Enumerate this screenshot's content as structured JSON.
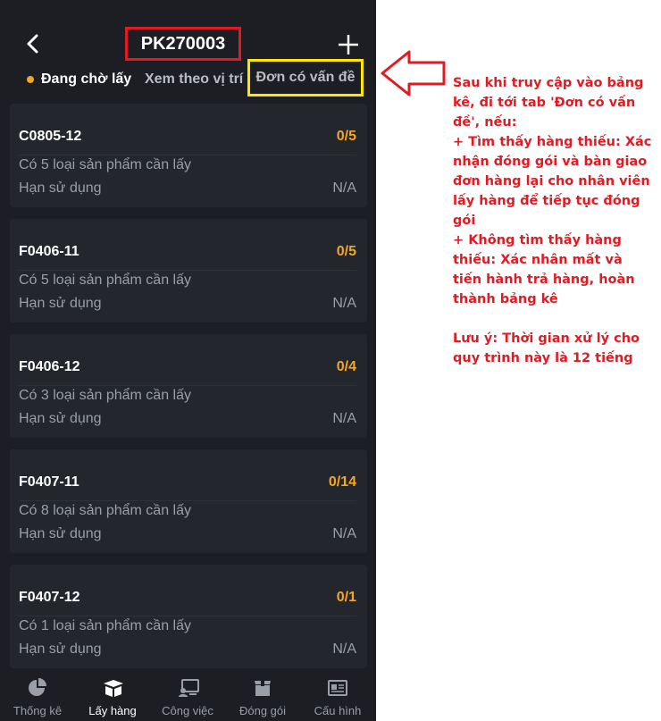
{
  "header": {
    "back_icon": "chevron-left-icon",
    "title": "PK270003",
    "add_icon": "plus-icon"
  },
  "tabs": [
    {
      "label": "Đang chờ lấy",
      "status_dot_color": "#f5a623"
    },
    {
      "label": "Xem theo vị trí"
    },
    {
      "label": "Đơn có vấn đề"
    }
  ],
  "cards": [
    {
      "code": "C0805-12",
      "count": "0/5",
      "desc": "Có 5 loại sản phẩm cần lấy",
      "expiry_label": "Hạn sử dụng",
      "expiry_value": "N/A"
    },
    {
      "code": "F0406-11",
      "count": "0/5",
      "desc": "Có 5 loại sản phẩm cần lấy",
      "expiry_label": "Hạn sử dụng",
      "expiry_value": "N/A"
    },
    {
      "code": "F0406-12",
      "count": "0/4",
      "desc": "Có 3 loại sản phẩm cần lấy",
      "expiry_label": "Hạn sử dụng",
      "expiry_value": "N/A"
    },
    {
      "code": "F0407-11",
      "count": "0/14",
      "desc": "Có 8 loại sản phẩm cần lấy",
      "expiry_label": "Hạn sử dụng",
      "expiry_value": "N/A"
    },
    {
      "code": "F0407-12",
      "count": "0/1",
      "desc": "Có 1 loại sản phẩm cần lấy",
      "expiry_label": "Hạn sử dụng",
      "expiry_value": "N/A"
    }
  ],
  "bottom_nav": [
    {
      "label": "Thống kê",
      "icon": "pie-chart-icon"
    },
    {
      "label": "Lấy hàng",
      "icon": "box-open-icon",
      "active": true
    },
    {
      "label": "Công việc",
      "icon": "task-board-icon"
    },
    {
      "label": "Đóng gói",
      "icon": "package-icon"
    },
    {
      "label": "Cấu hình",
      "icon": "id-card-icon"
    }
  ],
  "annotation": {
    "lines": [
      "Sau khi truy cập vào bảng kê, đi tới tab 'Đơn có vấn đề', nếu:",
      " + Tìm thấy hàng thiếu: Xác nhận đóng gói và bàn giao đơn hàng lại cho nhân viên lấy hàng để tiếp tục đóng gói",
      " + Không tìm thấy hàng thiếu: Xác nhân mất và tiến hành trả hàng, hoàn thành bảng kê",
      "Lưu ý: Thời gian xử lý cho quy trình này là 12 tiếng"
    ],
    "arrow_icon": "left-arrow-icon"
  },
  "colors": {
    "background": "#1c1e23",
    "card": "#23262c",
    "accent": "#f5a623",
    "highlight_red": "#e21b23",
    "highlight_yellow": "#ffe600"
  }
}
